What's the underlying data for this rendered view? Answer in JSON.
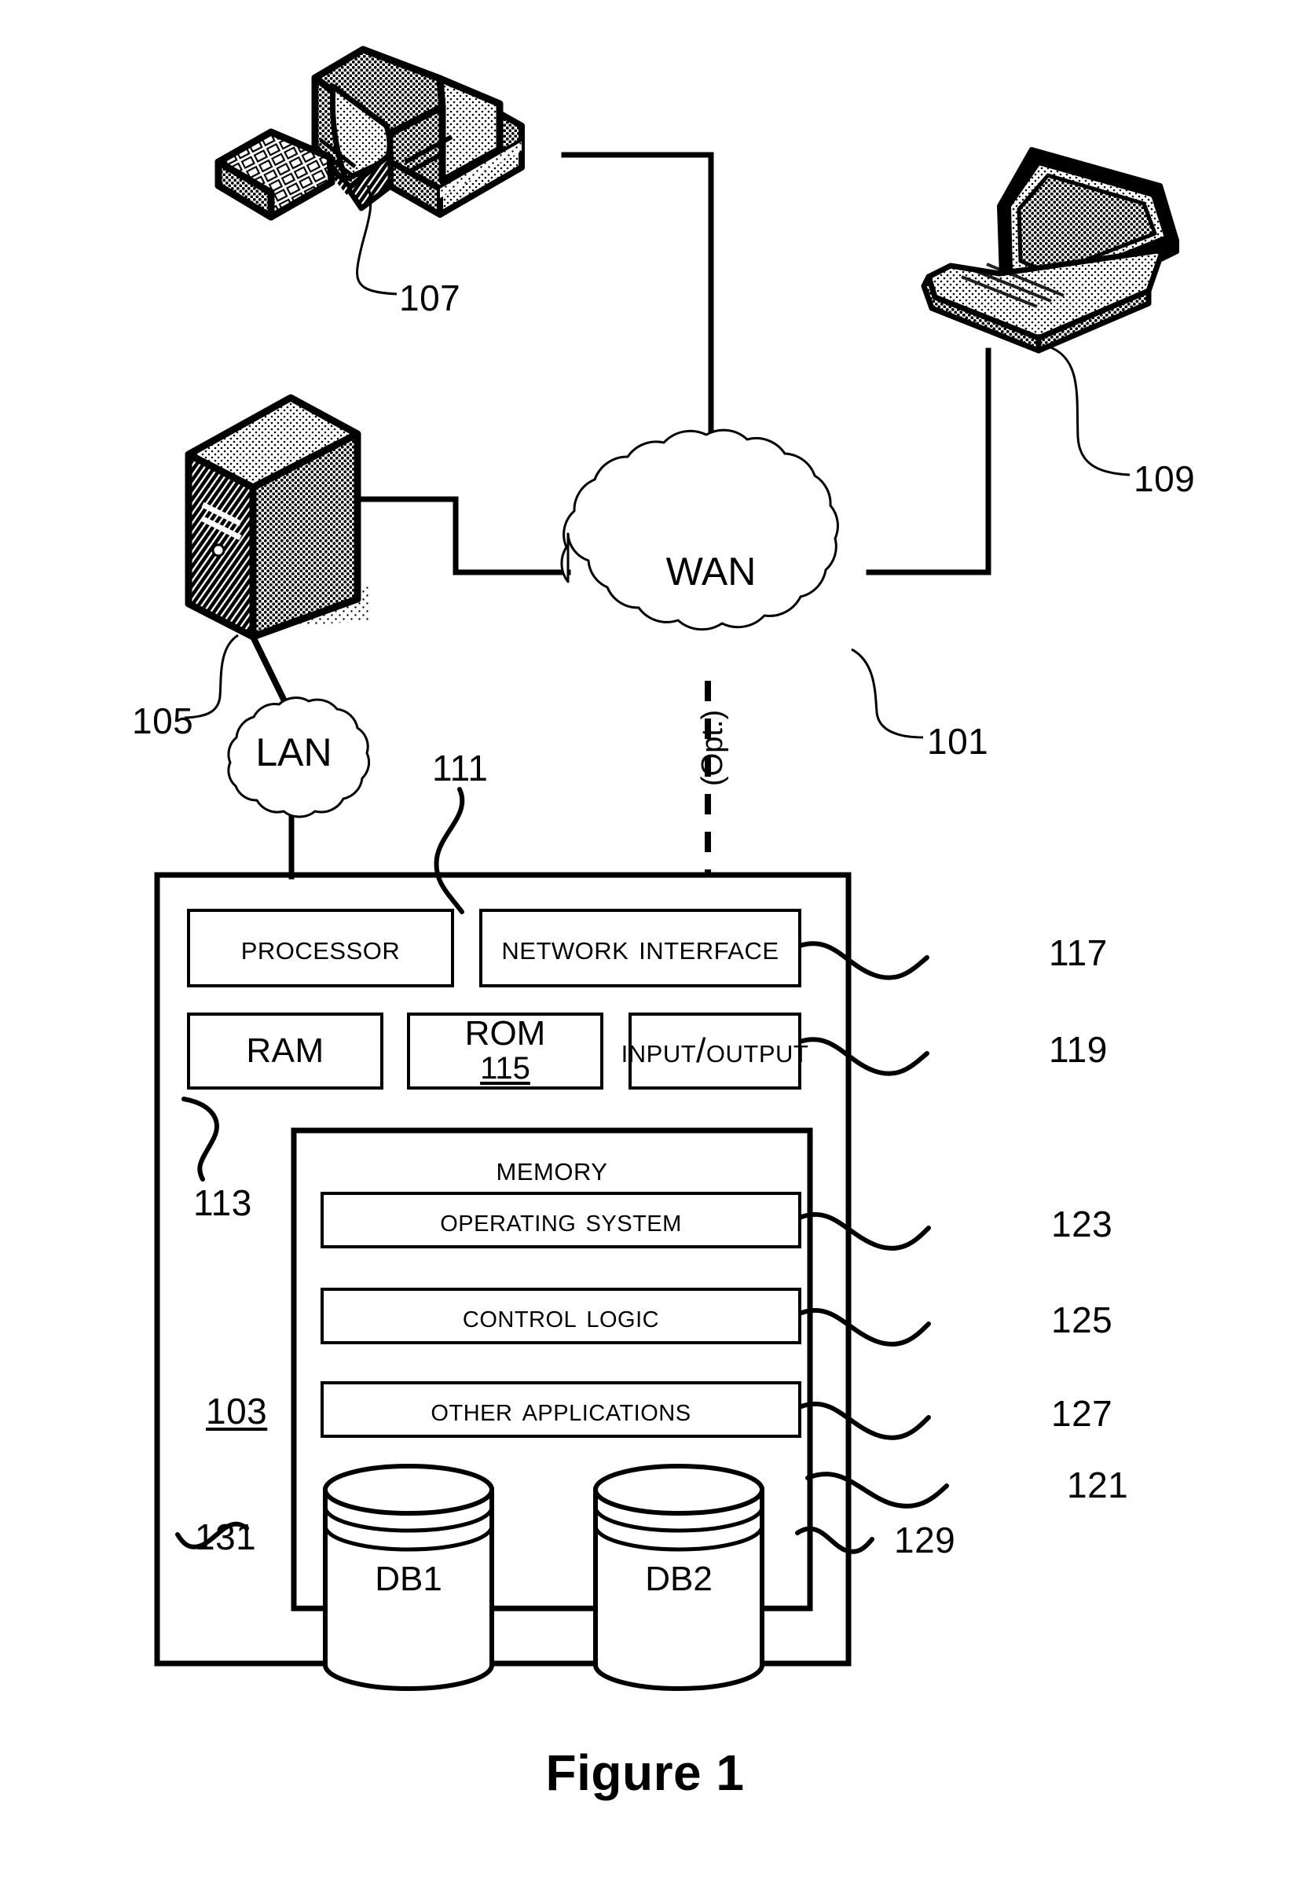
{
  "figure": {
    "caption": "Figure 1",
    "title_ref": "103"
  },
  "clouds": [
    {
      "name": "wan",
      "label": "WAN",
      "ref": "101"
    },
    {
      "name": "lan",
      "label": "LAN",
      "ref": ""
    }
  ],
  "devices": [
    {
      "name": "desktop-computer",
      "ref": "107",
      "icon": "desktop-computer-icon"
    },
    {
      "name": "laptop-computer",
      "ref": "109",
      "icon": "laptop-icon"
    },
    {
      "name": "server-tower",
      "ref": "105",
      "icon": "server-tower-icon"
    }
  ],
  "optional_link": {
    "label": "(Opt.)"
  },
  "computing_device": {
    "ref": "103",
    "blocks": [
      {
        "name": "processor",
        "label": "Processor",
        "ref": "111"
      },
      {
        "name": "network-interface",
        "label": "Network interface",
        "ref": "117"
      },
      {
        "name": "ram",
        "label": "RAM",
        "ref": "113"
      },
      {
        "name": "rom",
        "label": "ROM",
        "ref": "115"
      },
      {
        "name": "input-output",
        "label": "Input/output",
        "ref": "119"
      }
    ],
    "memory": {
      "name": "memory",
      "label": "Memory",
      "ref": "121",
      "items": [
        {
          "name": "operating-system",
          "label": "Operating system",
          "ref": "123"
        },
        {
          "name": "control-logic",
          "label": "Control logic",
          "ref": "125"
        },
        {
          "name": "other-applications",
          "label": "Other applications",
          "ref": "127"
        }
      ],
      "databases": [
        {
          "name": "database-1",
          "label": "DB1",
          "ref": "131"
        },
        {
          "name": "database-2",
          "label": "DB2",
          "ref": "129"
        }
      ]
    }
  },
  "colors": {
    "ink": "#000000",
    "paper": "#ffffff"
  }
}
